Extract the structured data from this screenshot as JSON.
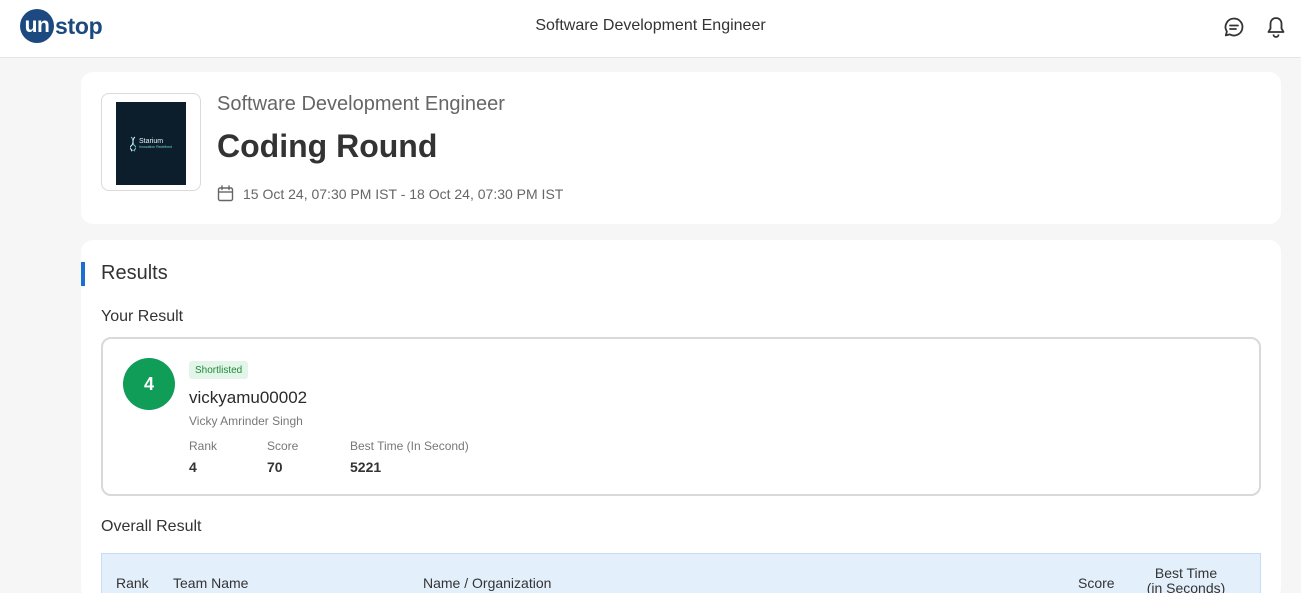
{
  "header": {
    "logo_initial": "un",
    "logo_rest": "stop",
    "title": "Software Development Engineer",
    "icons": [
      "chat-icon",
      "bell-icon"
    ]
  },
  "event": {
    "organization_logo_text": "Starium",
    "organization_logo_tagline": "Innovation Redefined",
    "subtitle": "Software Development Engineer",
    "title": "Coding Round",
    "dates": "15 Oct 24, 07:30 PM IST - 18 Oct 24, 07:30 PM IST"
  },
  "results": {
    "heading": "Results",
    "your_result_label": "Your Result",
    "rank_badge": "4",
    "status": "Shortlisted",
    "username": "vickyamu00002",
    "full_name": "Vicky Amrinder Singh",
    "stats": [
      {
        "label": "Rank",
        "value": "4"
      },
      {
        "label": "Score",
        "value": "70"
      },
      {
        "label": "Best Time (In Second)",
        "value": "5221"
      }
    ],
    "overall_label": "Overall Result",
    "table_columns": {
      "rank": "Rank",
      "team": "Team Name",
      "name": "Name / Organization",
      "score": "Score",
      "time_line1": "Best Time",
      "time_line2": "(in Seconds)"
    }
  },
  "colors": {
    "brand": "#1c4980",
    "accent": "#1c6fd1",
    "rank_circle": "#0f9d58",
    "status_badge_bg": "#e3f5e8",
    "status_badge_text": "#1e8a3c",
    "table_header_bg": "#e4effc"
  }
}
